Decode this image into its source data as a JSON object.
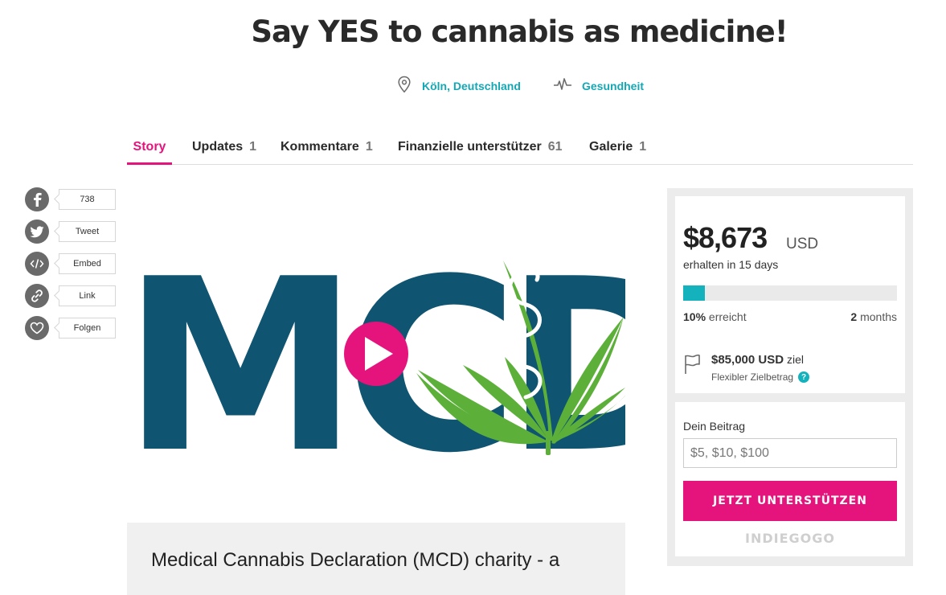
{
  "title": "Say YES to cannabis as medicine!",
  "meta": {
    "location": "Köln, Deutschland",
    "category": "Gesundheit",
    "location_icon": "location-pin-icon",
    "category_icon": "pulse-icon"
  },
  "tabs": [
    {
      "label": "Story",
      "count": "",
      "active": true
    },
    {
      "label": "Updates",
      "count": "1"
    },
    {
      "label": "Kommentare",
      "count": "1"
    },
    {
      "label": "Finanzielle unterstützer",
      "count": "61"
    },
    {
      "label": "Galerie",
      "count": "1"
    }
  ],
  "share": [
    {
      "icon": "facebook-icon",
      "label": "738"
    },
    {
      "icon": "twitter-icon",
      "label": "Tweet"
    },
    {
      "icon": "embed-icon",
      "label": "Embed"
    },
    {
      "icon": "link-icon",
      "label": "Link"
    },
    {
      "icon": "heart-icon",
      "label": "Folgen"
    }
  ],
  "media": {
    "logo_text": "MCD",
    "logo_color": "#0f5470",
    "leaf_color": "#5cb03a",
    "play_color": "#e5147c"
  },
  "description": {
    "line1": "Medical Cannabis Declaration (MCD) charity - a"
  },
  "funding": {
    "amount": "$8,673",
    "currency": "USD",
    "received": "erhalten in 15 days",
    "progress_fraction": 0.1,
    "percent": "10%",
    "percent_suffix": "erreicht",
    "time_num": "2",
    "time_unit": "months",
    "goal": "$85,000 USD",
    "goal_suffix": "ziel",
    "flexible": "Flexibler Zielbetrag",
    "help": "?"
  },
  "contribution": {
    "label": "Dein Beitrag",
    "placeholder": "$5, $10, $100",
    "button": "JETZT UNTERSTÜTZEN",
    "brand": "INDIEGOGO"
  },
  "colors": {
    "accent": "#e5147c",
    "teal": "#13b2bc"
  }
}
